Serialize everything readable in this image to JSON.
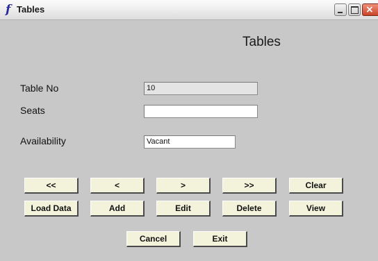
{
  "window": {
    "app_icon": "f",
    "title": "Tables",
    "controls": {
      "minimize": "minimize-icon",
      "maximize": "maximize-icon",
      "close": "×"
    }
  },
  "form": {
    "heading": "Tables",
    "fields": {
      "table_no": {
        "label": "Table No",
        "value": "10"
      },
      "seats": {
        "label": "Seats",
        "value": ""
      },
      "availability": {
        "label": "Availability",
        "value": "Vacant"
      }
    }
  },
  "buttons": {
    "first": "<<",
    "previous": "<",
    "next": ">",
    "last": ">>",
    "clear": "Clear",
    "load_data": "Load Data",
    "add": "Add",
    "edit": "Edit",
    "delete": "Delete",
    "view": "View",
    "cancel": "Cancel",
    "exit": "Exit"
  },
  "colors": {
    "background": "#c8c8c8",
    "button_face": "#f3f3dc",
    "close_button": "#c8452a"
  }
}
